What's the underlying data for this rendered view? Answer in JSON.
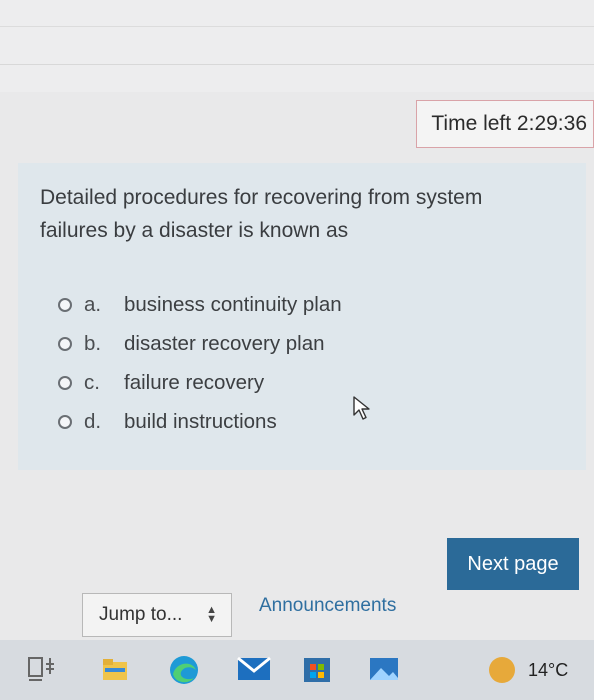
{
  "timer": {
    "label": "Time left 2:29:36"
  },
  "question": {
    "text": "Detailed procedures for recovering from system failures by a disaster is known as",
    "options": [
      {
        "letter": "a.",
        "text": "business continuity plan"
      },
      {
        "letter": "b.",
        "text": "disaster recovery plan"
      },
      {
        "letter": "c.",
        "text": "failure recovery"
      },
      {
        "letter": "d.",
        "text": "build instructions"
      }
    ]
  },
  "nav": {
    "next_label": "Next page",
    "jump_label": "Jump to...",
    "announcements_label": "Announcements"
  },
  "taskbar": {
    "icons": [
      "task-view-icon",
      "file-explorer-icon",
      "edge-browser-icon",
      "mail-icon",
      "store-icon",
      "photos-icon"
    ],
    "temperature": "14°C"
  },
  "colors": {
    "next_button": "#2b6a98",
    "link": "#2f6fa0",
    "timer_border": "#d9a3a8"
  }
}
